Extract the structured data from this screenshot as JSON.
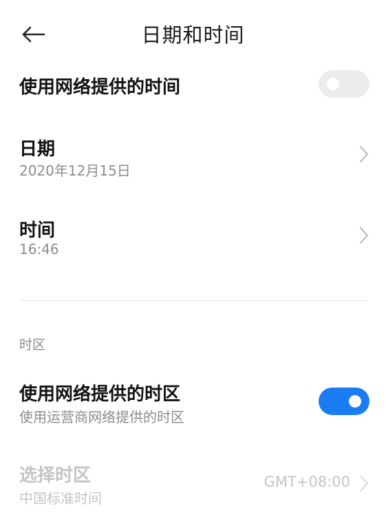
{
  "header": {
    "title": "日期和时间",
    "back_icon": "arrow-left-icon"
  },
  "network_time": {
    "title": "使用网络提供的时间",
    "enabled": false
  },
  "date": {
    "title": "日期",
    "value": "2020年12月15日"
  },
  "time": {
    "title": "时间",
    "value": "16:46"
  },
  "timezone_section": {
    "label": "时区"
  },
  "network_timezone": {
    "title": "使用网络提供的时区",
    "subtitle": "使用运营商网络提供的时区",
    "enabled": true
  },
  "select_timezone": {
    "title": "选择时区",
    "subtitle": "中国标准时间",
    "value": "GMT+08:00",
    "disabled": true
  },
  "colors": {
    "toggle_on": "#1a7cf2",
    "toggle_off": "#ececec",
    "secondary_text": "#8c8c8c",
    "disabled_text": "#c4c4c4"
  }
}
